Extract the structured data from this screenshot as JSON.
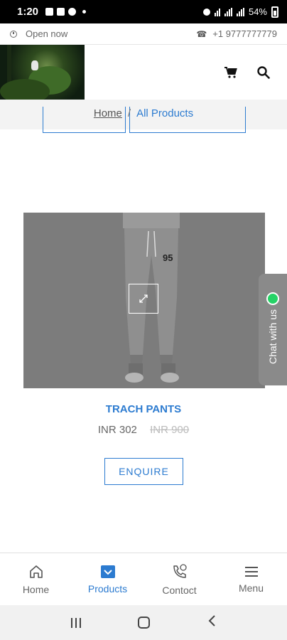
{
  "status_bar": {
    "time": "1:20",
    "battery": "54%"
  },
  "topbar": {
    "open_status": "Open now",
    "phone": "+1 9777777779"
  },
  "breadcrumb": {
    "home": "Home",
    "separator": "/",
    "current": "All Products"
  },
  "product": {
    "name": "TRACH PANTS",
    "price": "INR 302",
    "old_price": "INR 900",
    "jersey_number": "95",
    "enquire_label": "ENQUIRE"
  },
  "chat": {
    "label": "Chat with us"
  },
  "bottom_nav": {
    "items": [
      {
        "label": "Home",
        "icon": "home-icon"
      },
      {
        "label": "Products",
        "icon": "products-icon"
      },
      {
        "label": "Contoct",
        "icon": "contact-icon"
      },
      {
        "label": "Menu",
        "icon": "menu-icon"
      }
    ],
    "active": "Products"
  },
  "colors": {
    "accent": "#2c7bd0",
    "whatsapp": "#25d366"
  }
}
